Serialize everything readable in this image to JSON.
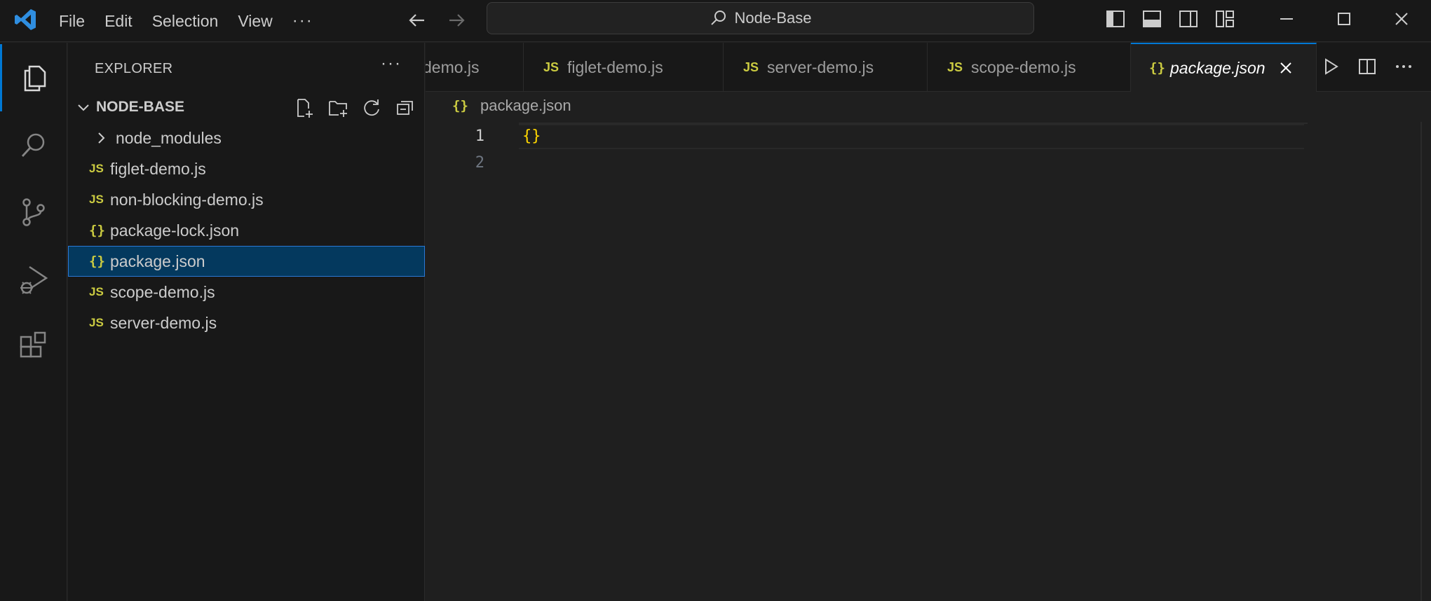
{
  "titlebar": {
    "menu": [
      "File",
      "Edit",
      "Selection",
      "View"
    ],
    "more": "···",
    "search": "Node-Base"
  },
  "sidebar": {
    "title": "EXPLORER",
    "more": "···",
    "folder": "NODE-BASE",
    "items": [
      {
        "label": "node_modules",
        "icon": "folder-chevron"
      },
      {
        "label": "figlet-demo.js",
        "icon": "JS"
      },
      {
        "label": "non-blocking-demo.js",
        "icon": "JS"
      },
      {
        "label": "package-lock.json",
        "icon": "{}"
      },
      {
        "label": "package.json",
        "icon": "{}",
        "selected": true
      },
      {
        "label": "scope-demo.js",
        "icon": "JS"
      },
      {
        "label": "server-demo.js",
        "icon": "JS"
      }
    ]
  },
  "tabs": [
    {
      "label": "demo.js",
      "icon": "JS"
    },
    {
      "label": "figlet-demo.js",
      "icon": "JS"
    },
    {
      "label": "server-demo.js",
      "icon": "JS"
    },
    {
      "label": "scope-demo.js",
      "icon": "JS"
    },
    {
      "label": "package.json",
      "icon": "{}",
      "active": true
    }
  ],
  "icon_text": {
    "js": "JS",
    "json": "{}"
  },
  "breadcrumb": {
    "file": "package.json"
  },
  "editor": {
    "lines": [
      {
        "number": "1",
        "code": "{}"
      },
      {
        "number": "2",
        "code": ""
      }
    ]
  },
  "colors": {
    "accent": "#0078d4",
    "json_icon": "#cbcb41",
    "bracket": "#ffd700",
    "selection": "#04395e"
  }
}
